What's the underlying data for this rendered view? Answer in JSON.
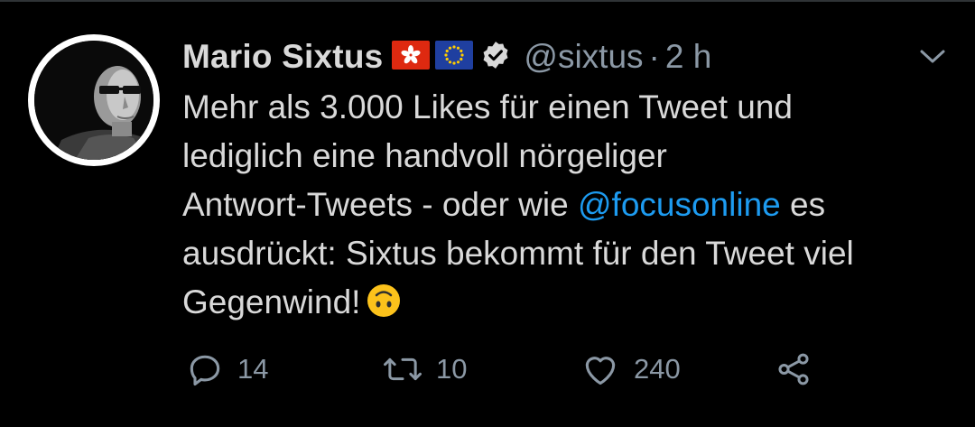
{
  "tweet": {
    "author": {
      "display_name": "Mario Sixtus",
      "handle": "@sixtus",
      "verified": true,
      "flags": [
        "hong-kong-flag-icon",
        "eu-flag-icon"
      ]
    },
    "separator": "·",
    "time": "2 h",
    "text": {
      "line1": "Mehr als 3.000 Likes für einen Tweet und",
      "line2": "lediglich eine handvoll nörgeliger",
      "line3_before": "Antwort-Tweets - oder wie ",
      "mention": "@focusonline",
      "line3_after": " es",
      "line4": "ausdrückt: Sixtus bekommt für den Tweet viel",
      "line5": "Gegenwind!",
      "emoji": "upside-down-face-emoji"
    },
    "actions": {
      "replies": "14",
      "retweets": "10",
      "likes": "240"
    }
  },
  "colors": {
    "background": "#000000",
    "text": "#d9d9d9",
    "secondary": "#8b98a5",
    "link": "#1d9bf0"
  }
}
